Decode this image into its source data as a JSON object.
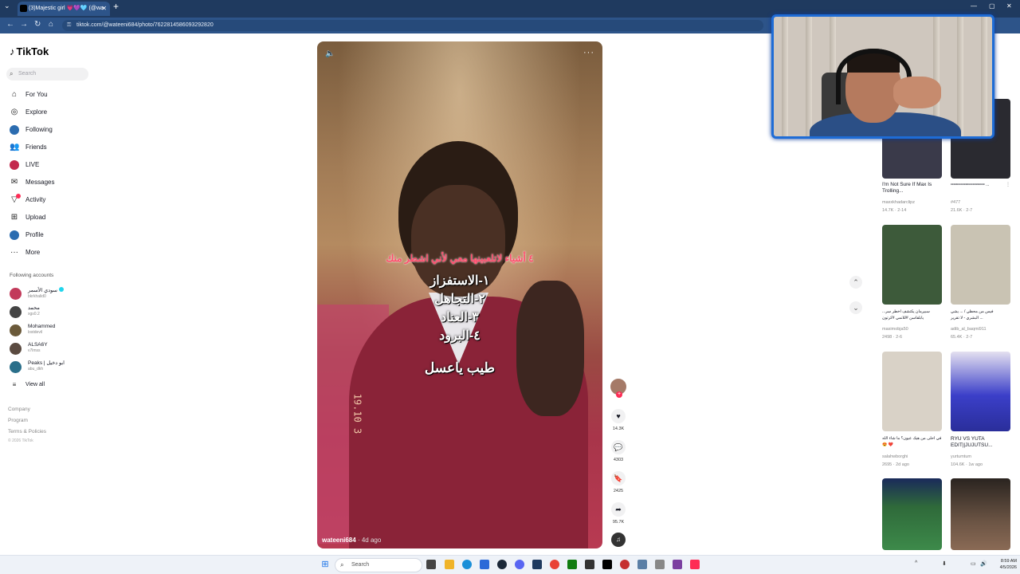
{
  "browser": {
    "tab_title": "(3)Majestic girl 💗💜🩵 (@wa",
    "url": "tiktok.com/@wateeni684/photo/7622814586093292820"
  },
  "sidebar": {
    "logo": "TikTok",
    "search_placeholder": "Search",
    "nav": [
      {
        "label": "For You",
        "icon": "home-icon"
      },
      {
        "label": "Explore",
        "icon": "compass-icon"
      },
      {
        "label": "Following",
        "icon": "following-avatar-icon"
      },
      {
        "label": "Friends",
        "icon": "friends-icon"
      },
      {
        "label": "LIVE",
        "icon": "live-icon"
      },
      {
        "label": "Messages",
        "icon": "messages-icon"
      },
      {
        "label": "Activity",
        "icon": "activity-icon"
      },
      {
        "label": "Upload",
        "icon": "upload-icon"
      },
      {
        "label": "Profile",
        "icon": "profile-avatar-icon"
      },
      {
        "label": "More",
        "icon": "more-icon"
      }
    ],
    "following_title": "Following accounts",
    "accounts": [
      {
        "name": "سودي الأسمر",
        "handle": "bkrkhalid0",
        "verified": true
      },
      {
        "name": "محمد",
        "handle": "xgs0.2",
        "verified": false
      },
      {
        "name": "Mohammed",
        "handle": "lostdevil",
        "verified": false
      },
      {
        "name": "ALSA6Y",
        "handle": "v7lmss",
        "verified": false
      },
      {
        "name": "Peaks | ابو دخيل",
        "handle": "abu_dkh",
        "verified": false
      }
    ],
    "view_all": "View all",
    "footer": [
      "Company",
      "Program",
      "Terms & Policies"
    ],
    "copyright": "© 2026 TikTok"
  },
  "video": {
    "overlay_title": "٤ أشياء لاتلعبينها معي لأني اشطر منك",
    "overlay_lines": [
      "١-الاستفزاز",
      "٢-التجاهل",
      "٣-العناد",
      "٤-البرود"
    ],
    "overlay_footer": "طيب ياعسل",
    "author": "wateeni684",
    "posted": "· 4d ago",
    "side_marking": "19.10 3"
  },
  "actions": {
    "likes": "14.3K",
    "comments": "4303",
    "saves": "2425",
    "shares": "95.7K"
  },
  "recommended": [
    {
      "title": "I'm Not Sure If Max Is Trolling...",
      "author": "maxxkhadarclipz",
      "stats": "14.7K · 2-14",
      "thumb_color": "#3a3a4a"
    },
    {
      "title": "ᵉᵉᵉᵉᵉᵉᵉᵉᵉᵉᵉᵉᵉᵉᵉᵉᵉᵉᵉᵉᵉᵉᵉ ...",
      "author": "#477",
      "stats": "21.6K · 2-7",
      "thumb_color": "#2a2a30"
    },
    {
      "title": "سبيرمان يكتشف اخطر سر... يابلقاسن #للانمي #كرتون",
      "author": "maximobja50",
      "stats": "2498 · 2-6",
      "thumb_color": "#3d5a3a"
    },
    {
      "title": "فيس من محظي / ... يشي البشري - لا تقرير ...",
      "author": "adib_al_baqmi911",
      "stats": "65.4K · 2-7",
      "thumb_color": "#c9c3b3"
    },
    {
      "title": "في احلى من هيك عيون؟ ما شاء الله 😍 ❤️",
      "author": "salahwborghi",
      "stats": "2695 · 2d ago",
      "thumb_color": "#d9d2c7"
    },
    {
      "title": "RYU VS YUTA EDIT||JUJUTSU...",
      "author": "yurtumtum",
      "stats": "104.6K · 1w ago",
      "thumb_color": "#3b3fc9"
    },
    {
      "title": "",
      "author": "",
      "stats": "",
      "thumb_color": "#2f6a3a"
    },
    {
      "title": "",
      "author": "",
      "stats": "",
      "thumb_color": "#6b5444"
    }
  ],
  "taskbar": {
    "search_placeholder": "Search",
    "time": "8:59 AM",
    "date": "4/5/2026"
  },
  "colors": {
    "accent": "#fe2c55",
    "browser_frame": "#1f3a5f",
    "webcam_border": "#1e6cd6"
  }
}
